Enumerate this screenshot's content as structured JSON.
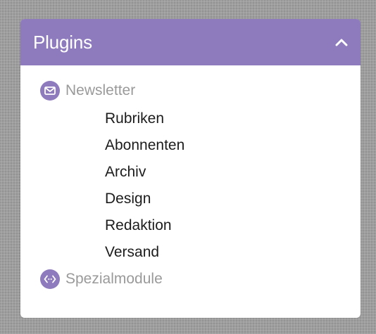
{
  "panel": {
    "title": "Plugins",
    "sections": [
      {
        "icon": "envelope-icon",
        "label": "Newsletter",
        "items": [
          {
            "label": "Rubriken"
          },
          {
            "label": "Abonnenten"
          },
          {
            "label": "Archiv"
          },
          {
            "label": "Design"
          },
          {
            "label": "Redaktion"
          },
          {
            "label": "Versand"
          }
        ]
      },
      {
        "icon": "code-diamond-icon",
        "label": "Spezialmodule"
      }
    ]
  },
  "colors": {
    "accent": "#8e7bbd",
    "section_text": "#9a9a9a",
    "item_text": "#1c1c1c",
    "background": "#9e9e9e"
  }
}
